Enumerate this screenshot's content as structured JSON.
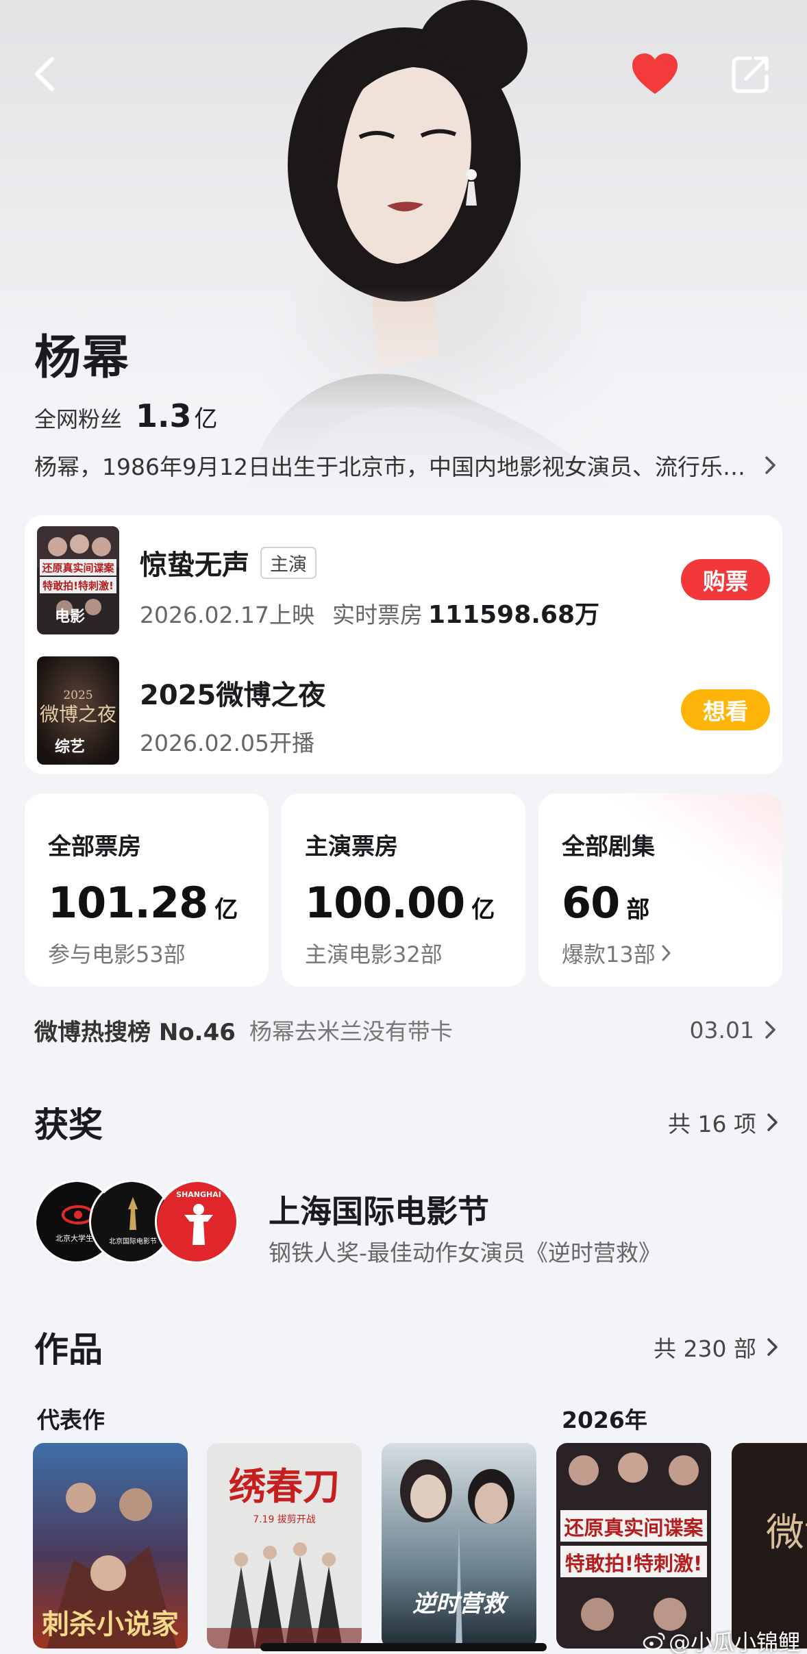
{
  "header": {
    "back_icon": "chevron-left-icon",
    "favorite_icon": "heart-icon",
    "share_icon": "share-icon",
    "favorite_color": "#f23a3a"
  },
  "profile": {
    "name": "杨幂",
    "fans_label": "全网粉丝",
    "fans_count": "1.3",
    "fans_unit": "亿",
    "bio": "杨幂，1986年9月12日出生于北京市，中国内地影视女演员、流行乐歌手、影视制片人。"
  },
  "current_works": [
    {
      "poster_tag": "电影",
      "poster_text": "还原真实间谍案 特敢拍!特刺激!",
      "title": "惊蛰无声",
      "role": "主演",
      "date": "2026.02.17上映",
      "box_office_label": "实时票房",
      "box_office_value": "111598.68万",
      "action": "购票",
      "action_color": "#f2383a"
    },
    {
      "poster_tag": "综艺",
      "poster_text": "2025 微博之夜",
      "title": "2025微博之夜",
      "date": "2026.02.05开播",
      "action": "想看",
      "action_color": "#ffb40a"
    }
  ],
  "stats": [
    {
      "label": "全部票房",
      "value": "101.28",
      "unit": "亿",
      "sub": "参与电影53部"
    },
    {
      "label": "主演票房",
      "value": "100.00",
      "unit": "亿",
      "sub": "主演电影32部"
    },
    {
      "label": "全部剧集",
      "value": "60",
      "unit": "部",
      "sub": "爆款13部"
    }
  ],
  "hot_search": {
    "label": "微博热搜榜 No.46",
    "text": "杨幂去米兰没有带卡",
    "date": "03.01"
  },
  "awards": {
    "title": "获奖",
    "count": "共 16 项",
    "festival": "上海国际电影节",
    "detail": "钢铁人奖-最佳动作女演员《逆时营救》",
    "logo1_text": "北京大学生电",
    "logo2_text": "北京国际电影节",
    "logo3_text": "SHANGHAI"
  },
  "filmography": {
    "title": "作品",
    "count": "共 230 部",
    "rep_label": "代表作",
    "year_label": "2026年",
    "posters": [
      {
        "text": "刺杀小说家"
      },
      {
        "text": "绣春刀",
        "sub": "7.19 拔剪开战"
      },
      {
        "text": "逆时营救"
      },
      {
        "text": "还原真实间谍案 特敢拍!特刺激!"
      },
      {
        "text": "微博"
      }
    ]
  },
  "watermark": "@小瓜小锦鲤"
}
